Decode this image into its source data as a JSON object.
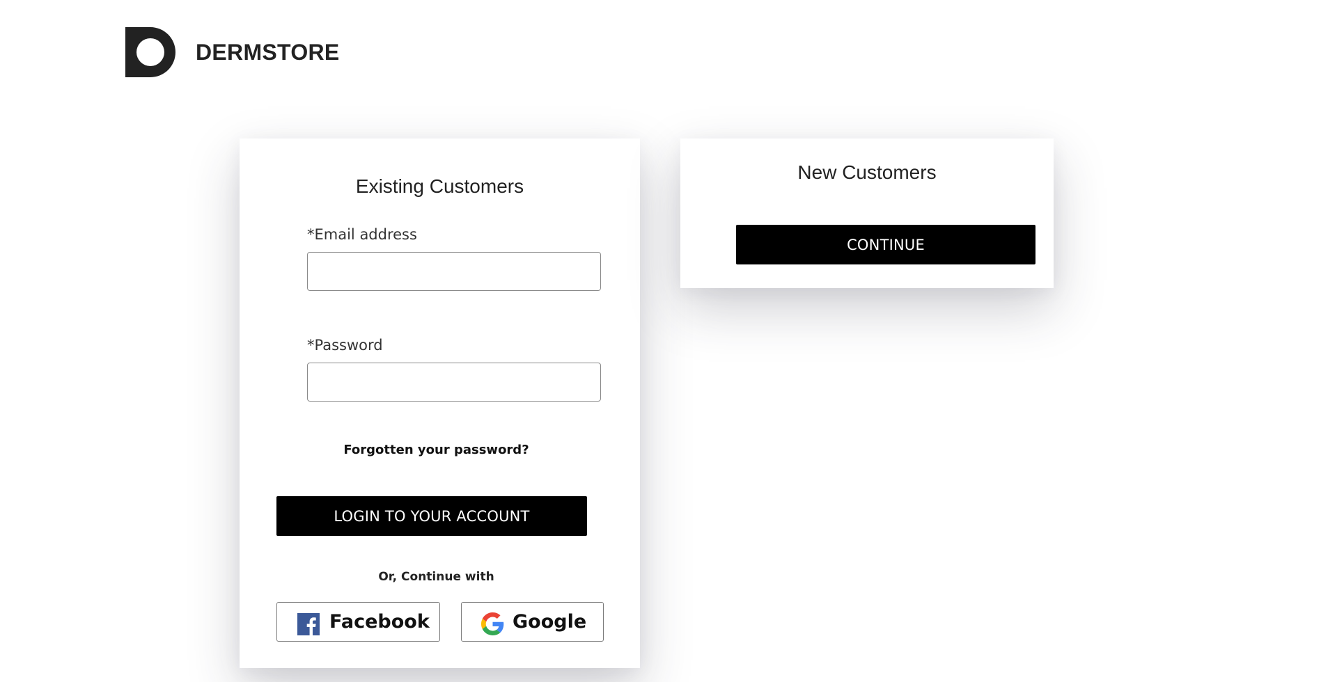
{
  "brand": {
    "name": "DERMSTORE",
    "logo_icon": "dermstore-d-logo"
  },
  "existing": {
    "title": "Existing Customers",
    "email_label": "*Email address",
    "email_value": "",
    "password_label": "*Password",
    "password_value": "",
    "forgot_link": "Forgotten your password?",
    "login_button": "LOGIN TO YOUR ACCOUNT",
    "or_text": "Or, Continue with",
    "social": {
      "facebook_label": "Facebook",
      "facebook_icon": "facebook-icon",
      "google_label": "Google",
      "google_icon": "google-icon"
    }
  },
  "new_customers": {
    "title": "New Customers",
    "continue_button": "CONTINUE"
  },
  "colors": {
    "primary_button": "#000000",
    "text": "#222222",
    "facebook_blue": "#3b5998"
  }
}
